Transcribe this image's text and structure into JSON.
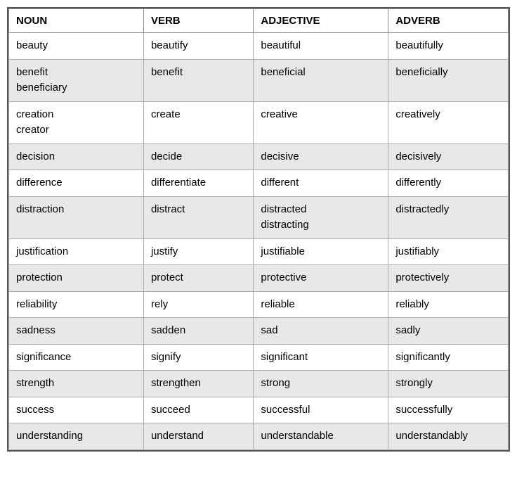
{
  "table": {
    "headers": {
      "noun": "NOUN",
      "verb": "VERB",
      "adjective": "ADJECTIVE",
      "adverb": "ADVERB"
    },
    "rows": [
      {
        "noun": "beauty",
        "verb": "beautify",
        "adjective": "beautiful",
        "adverb": "beautifully"
      },
      {
        "noun": "benefit\nbeneficiary",
        "verb": "benefit",
        "adjective": "beneficial",
        "adverb": "beneficially"
      },
      {
        "noun": "creation\ncreator",
        "verb": "create",
        "adjective": "creative",
        "adverb": "creatively"
      },
      {
        "noun": "decision",
        "verb": "decide",
        "adjective": "decisive",
        "adverb": "decisively"
      },
      {
        "noun": "difference",
        "verb": "differentiate",
        "adjective": "different",
        "adverb": "differently"
      },
      {
        "noun": "distraction",
        "verb": "distract",
        "adjective": "distracted\ndistracting",
        "adverb": "distractedly"
      },
      {
        "noun": "justification",
        "verb": "justify",
        "adjective": "justifiable",
        "adverb": "justifiably"
      },
      {
        "noun": "protection",
        "verb": "protect",
        "adjective": "protective",
        "adverb": "protectively"
      },
      {
        "noun": "reliability",
        "verb": "rely",
        "adjective": "reliable",
        "adverb": "reliably"
      },
      {
        "noun": "sadness",
        "verb": "sadden",
        "adjective": "sad",
        "adverb": "sadly"
      },
      {
        "noun": "significance",
        "verb": "signify",
        "adjective": "significant",
        "adverb": "significantly"
      },
      {
        "noun": "strength",
        "verb": "strengthen",
        "adjective": "strong",
        "adverb": "strongly"
      },
      {
        "noun": "success",
        "verb": "succeed",
        "adjective": "successful",
        "adverb": "successfully"
      },
      {
        "noun": "understanding",
        "verb": "understand",
        "adjective": "understandable",
        "adverb": "understandably"
      }
    ]
  }
}
